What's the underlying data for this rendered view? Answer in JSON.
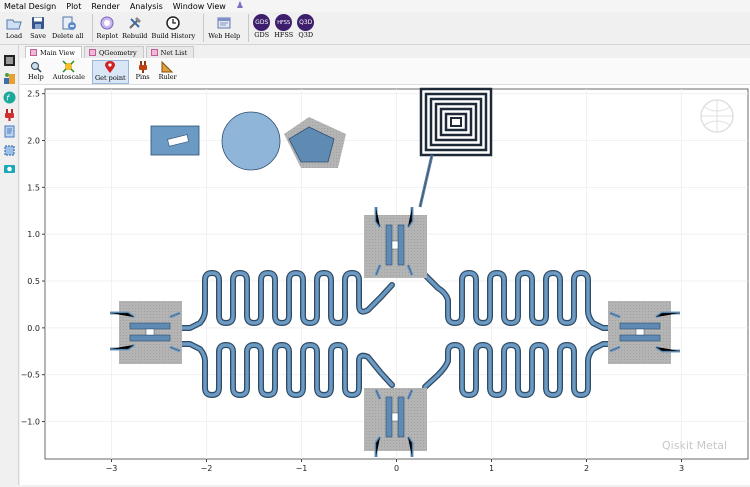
{
  "menu": [
    "Metal Design",
    "Plot",
    "Render",
    "Analysis",
    "Window View"
  ],
  "toolbar": {
    "buttons": [
      {
        "label": "Load",
        "icon": "load-icon"
      },
      {
        "label": "Save",
        "icon": "save-icon"
      },
      {
        "label": "Delete all",
        "icon": "delete-all-icon"
      },
      {
        "label": "Replot",
        "icon": "replot-icon"
      },
      {
        "label": "Rebuild",
        "icon": "rebuild-icon"
      },
      {
        "label": "Build History",
        "icon": "history-icon"
      },
      {
        "label": "Web Help",
        "icon": "web-help-icon"
      }
    ],
    "renderers": [
      {
        "badge": "GDS",
        "label": "GDS"
      },
      {
        "badge": "HFSS",
        "label": "HFSS"
      },
      {
        "badge": "Q3D",
        "label": "Q3D"
      }
    ]
  },
  "tabs": [
    "Main View",
    "QGeometry",
    "Net List"
  ],
  "subtools": [
    "Help",
    "Autoscale",
    "Get point",
    "Pins",
    "Ruler"
  ],
  "plot": {
    "watermark": "Qiskit Metal",
    "x_ticks": [
      "−3",
      "−2",
      "−1",
      "0",
      "1",
      "2",
      "3"
    ],
    "y_ticks": [
      "2.5",
      "2.0",
      "1.5",
      "1.0",
      "0.5",
      "0.0",
      "−0.5",
      "−1.0"
    ]
  },
  "chart_data": {
    "type": "scatter",
    "xlim": [
      -3.7,
      3.7
    ],
    "ylim": [
      -1.4,
      2.55
    ],
    "grid": true,
    "x_ticks": [
      -3,
      -2,
      -1,
      0,
      1,
      2,
      3
    ],
    "y_ticks": [
      2.5,
      2.0,
      1.5,
      1.0,
      0.5,
      0.0,
      -0.5,
      -1.0
    ],
    "title": ""
  },
  "colors": {
    "component_fill": "#6b9ac4",
    "pocket": "#b4b4b4",
    "circle_fill": "#8fb6d8",
    "trace": "#5b7e9e",
    "renderer_badge": "#3d1e6d"
  }
}
